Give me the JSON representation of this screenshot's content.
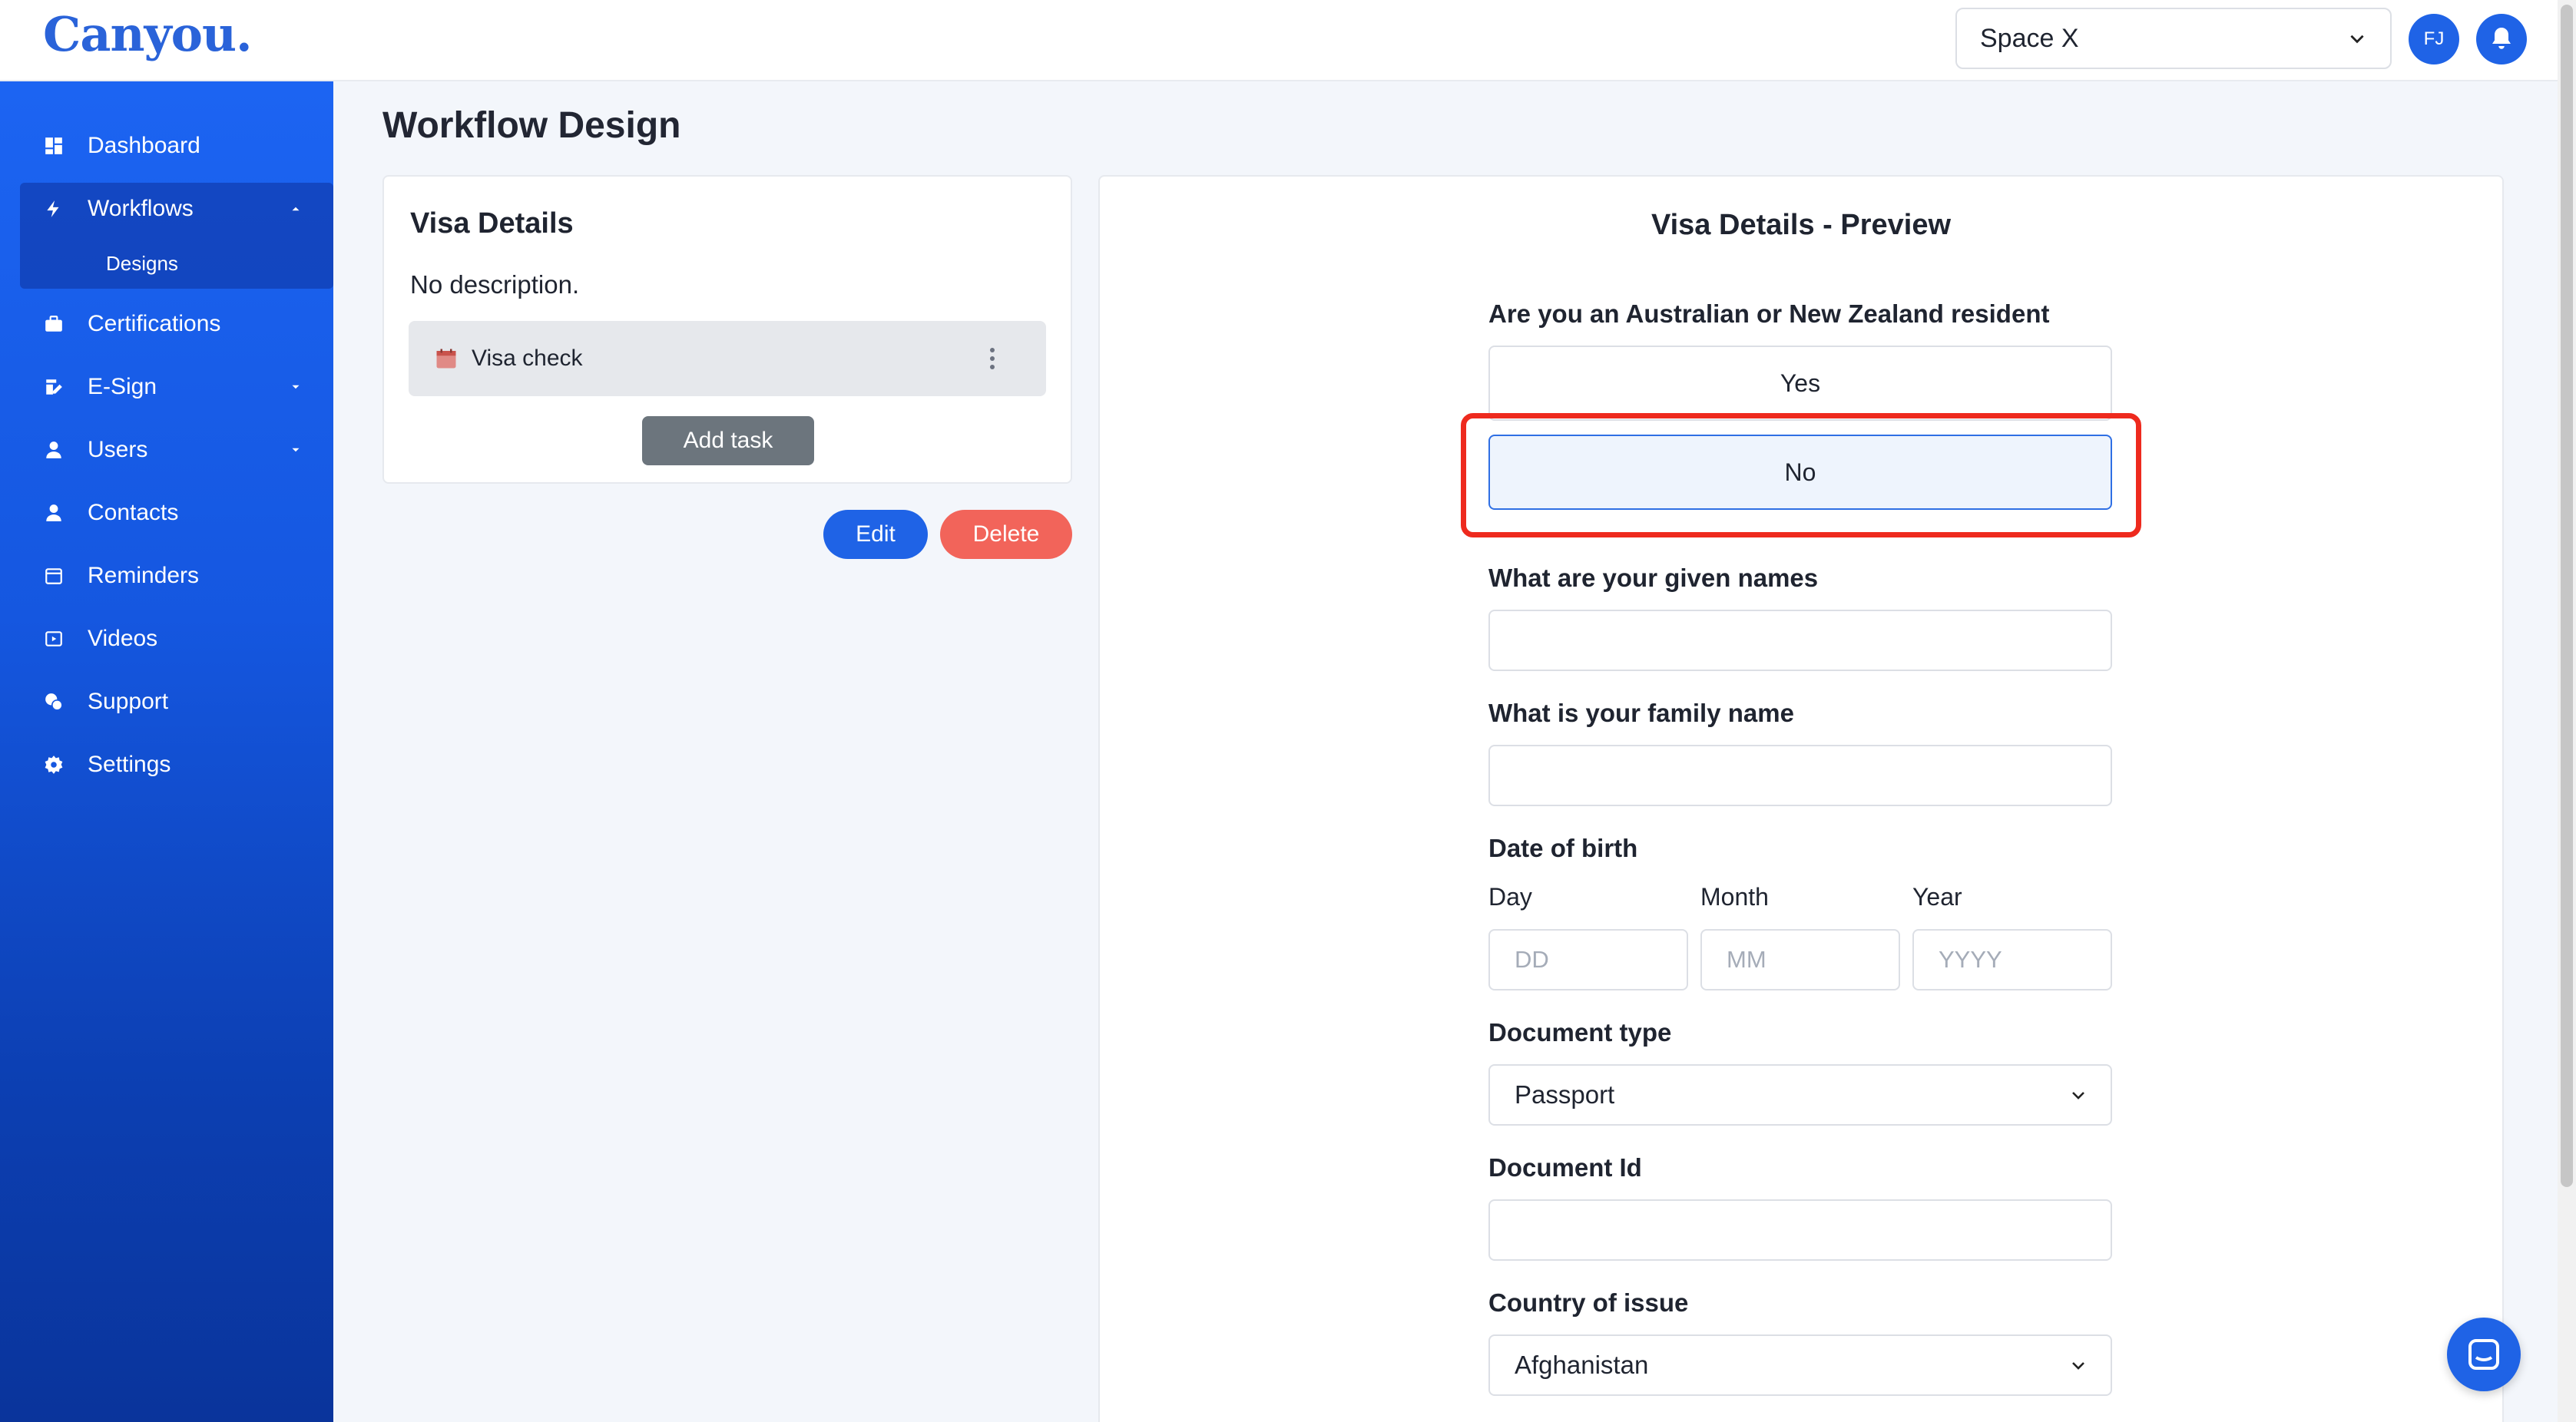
{
  "app": {
    "logo": "Canyou."
  },
  "header": {
    "space_select": "Space X",
    "avatar_initials": "FJ"
  },
  "sidebar": {
    "items": [
      {
        "label": "Dashboard",
        "icon": "dashboard-icon"
      },
      {
        "label": "Workflows",
        "icon": "bolt-icon",
        "expanded": true
      },
      {
        "label": "Certifications",
        "icon": "briefcase-icon"
      },
      {
        "label": "E-Sign",
        "icon": "signature-icon",
        "has_caret": true
      },
      {
        "label": "Users",
        "icon": "user-icon",
        "has_caret": true
      },
      {
        "label": "Contacts",
        "icon": "contact-icon"
      },
      {
        "label": "Reminders",
        "icon": "calendar-icon"
      },
      {
        "label": "Videos",
        "icon": "video-icon"
      },
      {
        "label": "Support",
        "icon": "support-icon"
      },
      {
        "label": "Settings",
        "icon": "gear-icon"
      }
    ],
    "subitems": [
      {
        "label": "Designs"
      }
    ]
  },
  "main": {
    "page_title": "Workflow Design",
    "workflow_card": {
      "title": "Visa Details",
      "description": "No description.",
      "tasks": [
        {
          "label": "Visa check",
          "icon": "calendar-icon"
        }
      ],
      "add_task_label": "Add task"
    },
    "edit_label": "Edit",
    "delete_label": "Delete",
    "preview": {
      "title": "Visa Details - Preview",
      "resident_question": "Are you an Australian or New Zealand resident",
      "options": [
        "Yes",
        "No"
      ],
      "selected_option": "No",
      "given_names_label": "What are your given names",
      "family_name_label": "What is your family name",
      "dob_label": "Date of birth",
      "dob_fields": [
        {
          "label": "Day",
          "placeholder": "DD"
        },
        {
          "label": "Month",
          "placeholder": "MM"
        },
        {
          "label": "Year",
          "placeholder": "YYYY"
        }
      ],
      "document_type_label": "Document type",
      "document_type_value": "Passport",
      "document_id_label": "Document Id",
      "country_label": "Country of issue",
      "country_value": "Afghanistan"
    }
  },
  "colors": {
    "accent": "#1f63e6",
    "danger": "#f2645a",
    "highlight": "#ee2a1e"
  }
}
